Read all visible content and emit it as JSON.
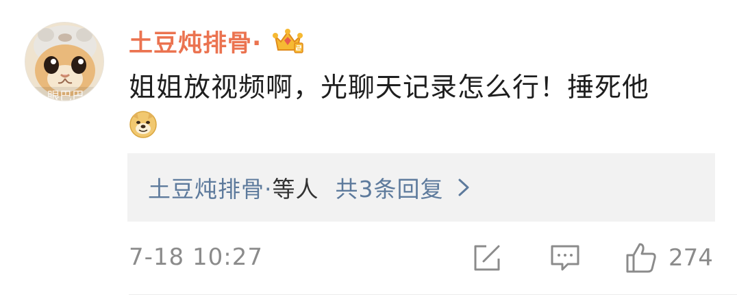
{
  "comment": {
    "username": "土豆炖排骨·",
    "avatar_watermark": "眼巴巴",
    "text": "姐姐放视频啊，光聊天记录怎么行！捶死他",
    "emoji": "doge-emoji",
    "badge": "vip-crown-badge",
    "replies": {
      "users": "土豆炖排骨·",
      "suffix": "等人",
      "count_label": "共3条回复"
    },
    "timestamp": "7-18 10:27",
    "like_count": "274"
  },
  "colors": {
    "username": "#eb7350",
    "reply_link": "#5d7a9c",
    "meta_text": "#8b8b8b",
    "reply_bg": "#f2f2f2"
  },
  "icons": [
    "share-icon",
    "comment-icon",
    "like-icon",
    "chevron-right-icon"
  ]
}
